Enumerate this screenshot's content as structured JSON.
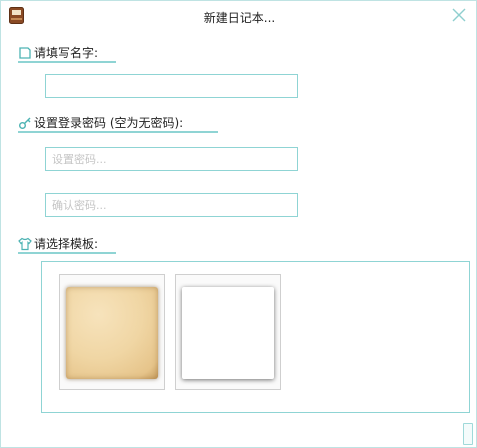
{
  "window": {
    "title": "新建日记本...",
    "icons": {
      "app": "notebook-icon",
      "close": "close-icon"
    }
  },
  "name_section": {
    "label": "请填写名字:",
    "icon": "edit-icon",
    "input_value": "",
    "input_placeholder": ""
  },
  "password_section": {
    "label": "设置登录密码 (空为无密码):",
    "icon": "key-icon",
    "password_placeholder": "设置密码...",
    "confirm_placeholder": "确认密码..."
  },
  "template_section": {
    "label": "请选择模板:",
    "icon": "shirt-icon",
    "templates": [
      "paper-template",
      "white-template"
    ]
  },
  "colors": {
    "accent": "#8fd4d4",
    "border": "#bfe3e3",
    "placeholder": "#c4c4c4",
    "paper": "#f0d6a4"
  }
}
